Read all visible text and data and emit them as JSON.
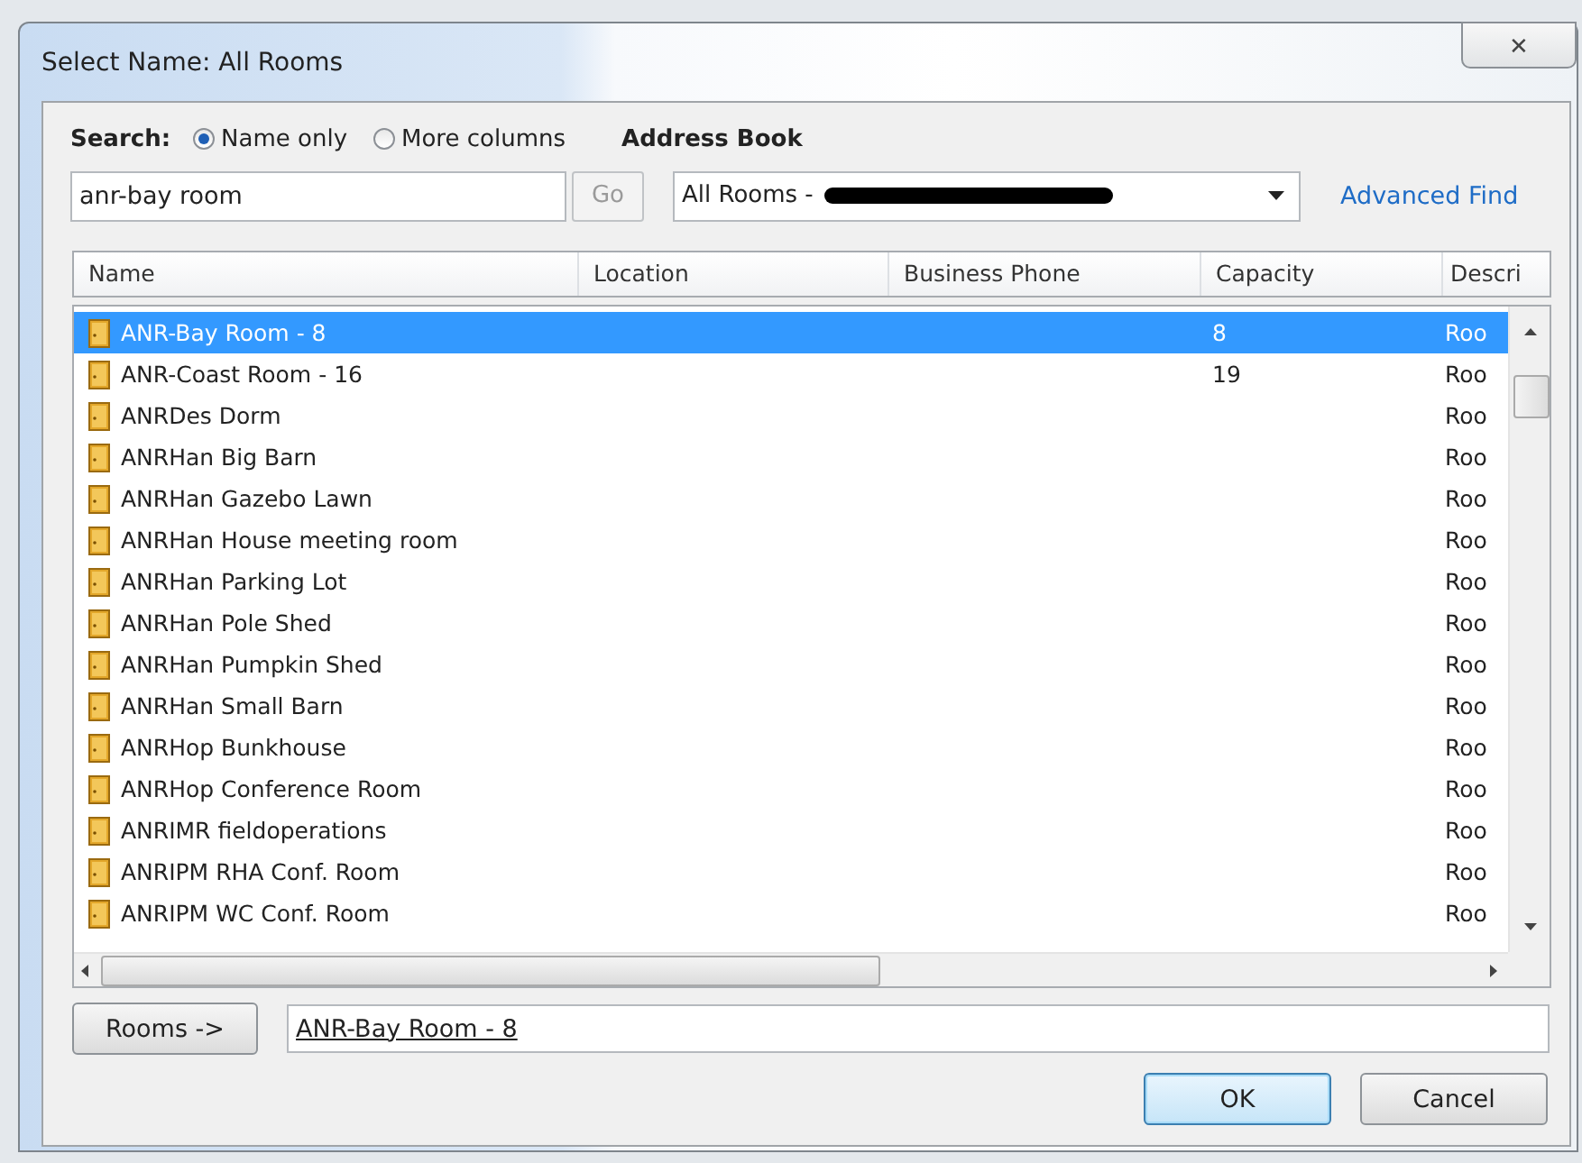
{
  "window": {
    "title": "Select Name: All Rooms",
    "close": "✕"
  },
  "search": {
    "label": "Search:",
    "options": [
      {
        "label": "Name only",
        "selected": true
      },
      {
        "label": "More columns",
        "selected": false
      }
    ],
    "value": "anr-bay room",
    "go_button": "Go"
  },
  "address_book": {
    "label": "Address Book",
    "value": "All Rooms -",
    "redacted": true,
    "advanced_find": "Advanced Find"
  },
  "table": {
    "columns": [
      "Name",
      "Location",
      "Business Phone",
      "Capacity",
      "Descri"
    ],
    "rows": [
      {
        "name": "ANR-Bay Room - 8",
        "capacity": "8",
        "description": "Roo",
        "selected": true
      },
      {
        "name": "ANR-Coast Room - 16",
        "capacity": "19",
        "description": "Roo",
        "selected": false
      },
      {
        "name": "ANRDes Dorm",
        "description": "Roo",
        "selected": false
      },
      {
        "name": "ANRHan Big Barn",
        "description": "Roo",
        "selected": false
      },
      {
        "name": "ANRHan Gazebo Lawn",
        "description": "Roo",
        "selected": false
      },
      {
        "name": "ANRHan House meeting room",
        "description": "Roo",
        "selected": false
      },
      {
        "name": "ANRHan Parking Lot",
        "description": "Roo",
        "selected": false
      },
      {
        "name": "ANRHan Pole Shed",
        "description": "Roo",
        "selected": false
      },
      {
        "name": "ANRHan Pumpkin Shed",
        "description": "Roo",
        "selected": false
      },
      {
        "name": "ANRHan Small Barn",
        "description": "Roo",
        "selected": false
      },
      {
        "name": "ANRHop Bunkhouse",
        "description": "Roo",
        "selected": false
      },
      {
        "name": "ANRHop Conference Room",
        "description": "Roo",
        "selected": false
      },
      {
        "name": "ANRIMR fieldoperations",
        "description": "Roo",
        "selected": false
      },
      {
        "name": "ANRIPM RHA Conf. Room",
        "description": "Roo",
        "selected": false
      },
      {
        "name": "ANRIPM WC Conf. Room",
        "description": "Roo",
        "selected": false
      }
    ]
  },
  "rooms_button": "Rooms ->",
  "rooms_value": "ANR-Bay Room - 8",
  "buttons": [
    {
      "label": "OK",
      "default": true
    },
    {
      "label": "Cancel",
      "default": false
    }
  ]
}
